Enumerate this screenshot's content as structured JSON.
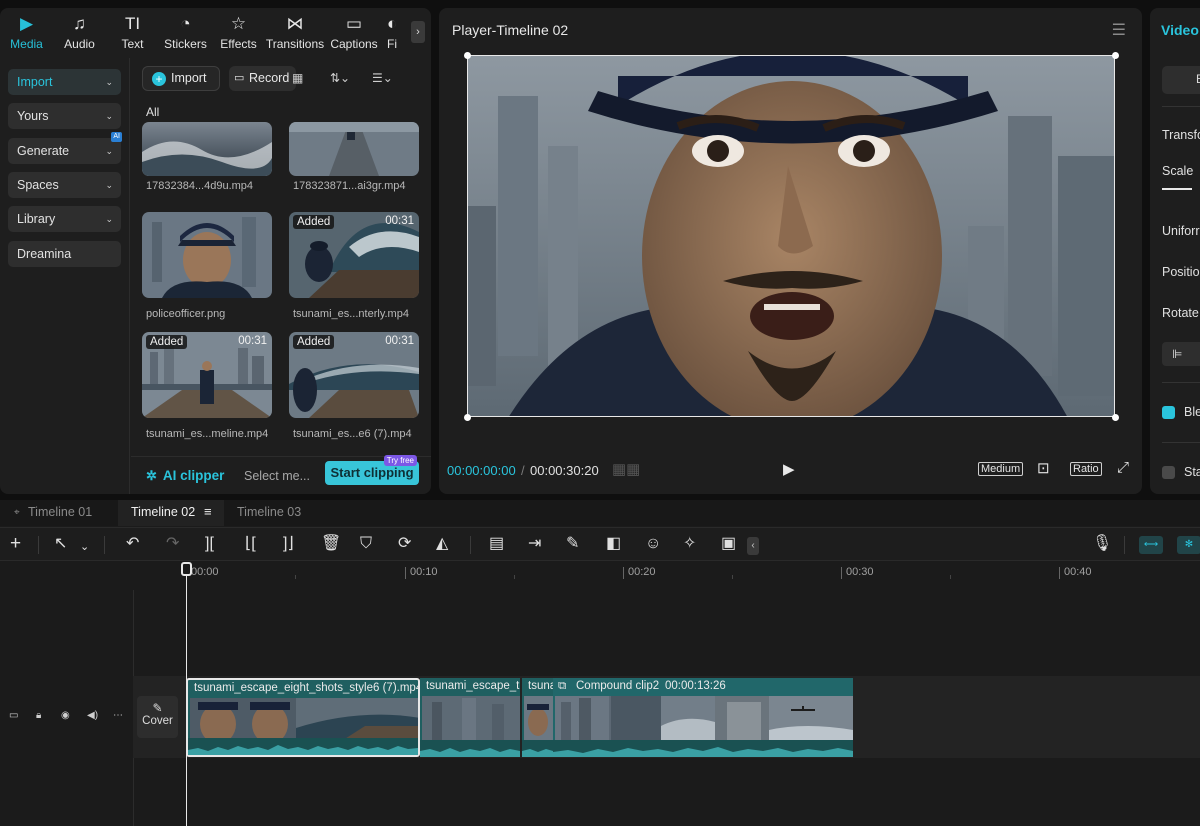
{
  "top_nav": {
    "tabs": [
      {
        "label": "Media",
        "icon": "media-icon",
        "glyph": "▶"
      },
      {
        "label": "Audio",
        "icon": "audio-icon",
        "glyph": "♫"
      },
      {
        "label": "Text",
        "icon": "text-icon",
        "glyph": "TI"
      },
      {
        "label": "Stickers",
        "icon": "stickers-icon",
        "glyph": "◔"
      },
      {
        "label": "Effects",
        "icon": "effects-icon",
        "glyph": "☆"
      },
      {
        "label": "Transitions",
        "icon": "transitions-icon",
        "glyph": "⋈"
      },
      {
        "label": "Captions",
        "icon": "captions-icon",
        "glyph": "▭"
      },
      {
        "label": "Fi",
        "icon": "filters-icon",
        "glyph": "◐"
      }
    ],
    "more_arrow": "›"
  },
  "sidebar": {
    "items": [
      {
        "label": "Import",
        "chevron": "⌄"
      },
      {
        "label": "Yours",
        "chevron": "⌄"
      },
      {
        "label": "Generate",
        "chevron": "⌄",
        "badge": "AI"
      },
      {
        "label": "Spaces",
        "chevron": "⌄"
      },
      {
        "label": "Library",
        "chevron": "⌄"
      },
      {
        "label": "Dreamina",
        "chevron": ""
      }
    ]
  },
  "media_toolbar": {
    "import_label": "Import",
    "record_label": "Record",
    "view_icon": "▦",
    "sort_icon": "⇅⌄",
    "filter_icon": "☰⌄"
  },
  "media": {
    "section_label": "All",
    "items": [
      {
        "caption": "17832384...4d9u.mp4",
        "badge": "",
        "duration": ""
      },
      {
        "caption": "178323871...ai3gr.mp4",
        "badge": "",
        "duration": ""
      },
      {
        "caption": "policeofficer.png",
        "badge": "",
        "duration": ""
      },
      {
        "caption": "tsunami_es...nterly.mp4",
        "badge": "Added",
        "duration": "00:31"
      },
      {
        "caption": "tsunami_es...meline.mp4",
        "badge": "Added",
        "duration": "00:31"
      },
      {
        "caption": "tsunami_es...e6 (7).mp4",
        "badge": "Added",
        "duration": "00:31"
      }
    ]
  },
  "ai_clipper": {
    "label": "AI clipper",
    "select_placeholder": "Select me...",
    "start_label": "Start clipping",
    "try_free": "Try free"
  },
  "player": {
    "title": "Player-Timeline 02",
    "current_time": "00:00:00:00",
    "separator": "/",
    "total_time": "00:00:30:20",
    "quality": "Medium",
    "ratio": "Ratio"
  },
  "right_panel": {
    "title": "Video",
    "box_label": "B",
    "transform": "Transfo",
    "scale": "Scale",
    "uniform": "Uniforr",
    "position": "Positio",
    "rotate": "Rotate",
    "blend": "Ble",
    "stabilize": "Sta"
  },
  "timeline": {
    "tabs": [
      "Timeline 01",
      "Timeline 02",
      "Timeline 03"
    ],
    "active_tab": 1,
    "ruler_labels": [
      "00:00",
      "00:10",
      "00:20",
      "00:30",
      "00:40"
    ],
    "cover_label": "Cover",
    "clips": [
      {
        "title": "tsunami_escape_eight_shots_style6 (7).mp4"
      },
      {
        "title": "tsunami_escape_tim"
      },
      {
        "title": "tsuna"
      },
      {
        "title": "Compound clip2",
        "duration": "00:00:13:26"
      }
    ]
  },
  "colors": {
    "accent": "#2ac4dc",
    "clip_bg": "#1f5f60",
    "panel_bg": "#1e1e1e"
  }
}
